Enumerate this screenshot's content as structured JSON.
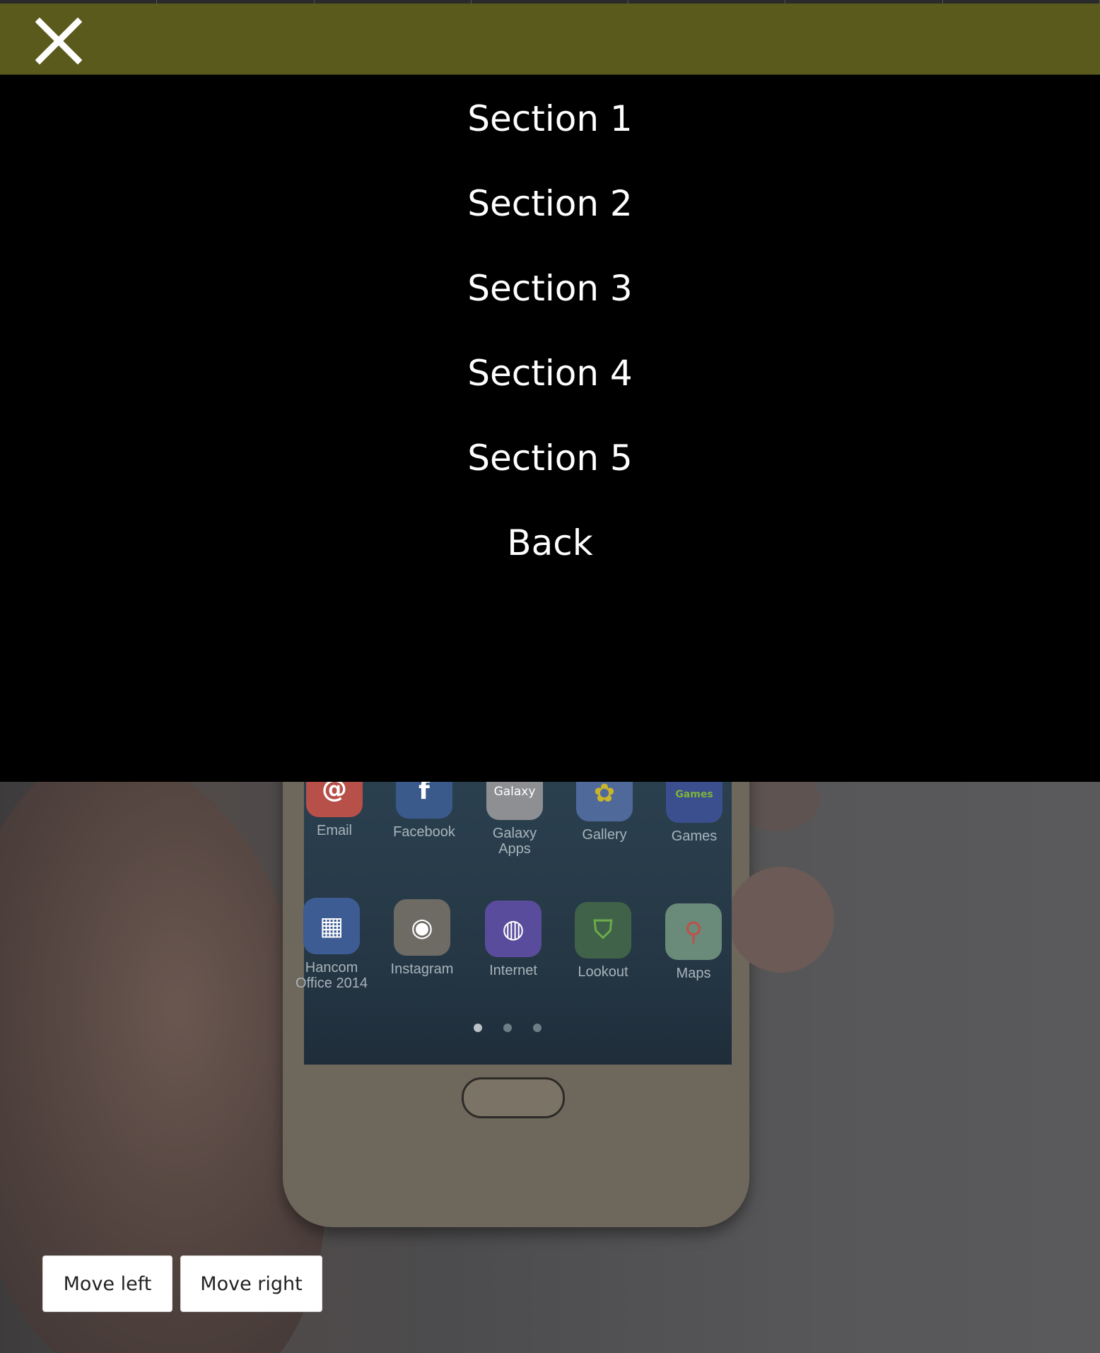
{
  "header": {
    "close_icon": "close-icon",
    "color": "#5b5a1d"
  },
  "menu": {
    "items": [
      {
        "label": "Section 1"
      },
      {
        "label": "Section 2"
      },
      {
        "label": "Section 3"
      },
      {
        "label": "Section 4"
      },
      {
        "label": "Section 5"
      },
      {
        "label": "Back"
      }
    ]
  },
  "background_apps": [
    {
      "label": "Email",
      "icon": "email-icon"
    },
    {
      "label": "Facebook",
      "icon": "facebook-icon"
    },
    {
      "label": "Galaxy Apps",
      "icon": "galaxy-apps-icon",
      "icon_text": "Galaxy"
    },
    {
      "label": "Gallery",
      "icon": "gallery-icon"
    },
    {
      "label": "Games",
      "icon": "games-icon",
      "icon_text": "Games"
    },
    {
      "label": "Hancom Office 2014",
      "icon": "hancom-office-icon"
    },
    {
      "label": "Instagram",
      "icon": "instagram-icon"
    },
    {
      "label": "Internet",
      "icon": "internet-icon"
    },
    {
      "label": "Lookout",
      "icon": "lookout-icon"
    },
    {
      "label": "Maps",
      "icon": "maps-icon"
    }
  ],
  "controls": {
    "move_left": "Move left",
    "move_right": "Move right"
  }
}
